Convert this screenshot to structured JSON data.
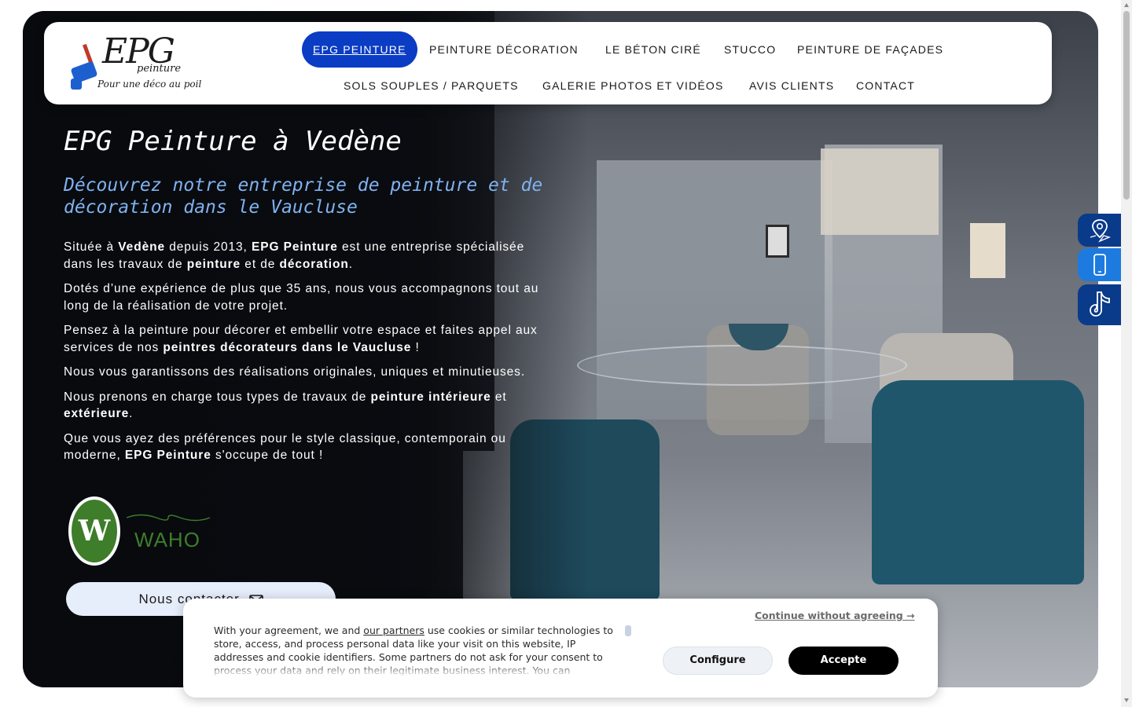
{
  "colors": {
    "nav_active_bg": "#0a3cc4",
    "subtitle": "#7fb2f0",
    "side_map_bg": "#0a3a8a",
    "side_phone_bg": "#1d7be0",
    "waho_green": "#3e7d2a",
    "accept_bg": "#000000"
  },
  "logo": {
    "main": "EPG",
    "sub": "peinture",
    "tagline": "Pour une déco au poil"
  },
  "nav": {
    "items": [
      {
        "label": "EPG PEINTURE",
        "active": true
      },
      {
        "label": "PEINTURE DÉCORATION"
      },
      {
        "label": "LE BÉTON CIRÉ"
      },
      {
        "label": "STUCCO"
      },
      {
        "label": "PEINTURE DE FAÇADES"
      },
      {
        "label": "SOLS SOUPLES / PARQUETS"
      },
      {
        "label": "GALERIE PHOTOS ET VIDÉOS"
      },
      {
        "label": "AVIS CLIENTS"
      },
      {
        "label": "CONTACT"
      }
    ]
  },
  "hero": {
    "title": "EPG Peinture à Vedène",
    "subtitle": "Découvrez notre entreprise de peinture et de décoration dans le Vaucluse",
    "p1": {
      "a": "Située à ",
      "b": "Vedène",
      "c": " depuis 2013, ",
      "d": "EPG Peinture",
      "e": " est une entreprise spécialisée dans les travaux de ",
      "f": "peinture",
      "g": " et de ",
      "h": "décoration",
      "i": "."
    },
    "p2": "Dotés d’une expérience de plus que 35 ans, nous vous accompagnons tout au long de la réalisation de votre projet.",
    "p3": {
      "a": "Pensez à la peinture pour décorer et embellir votre espace et faites appel aux services de nos ",
      "b": "peintres décorateurs dans le Vaucluse",
      "c": " !"
    },
    "p4": "Nous vous garantissons des réalisations originales, uniques et minutieuses.",
    "p5": {
      "a": "Nous prenons en charge tous types de travaux de ",
      "b": "peinture intérieure",
      "c": " et ",
      "d": "extérieure",
      "e": "."
    },
    "p6": {
      "a": "Que vous ayez des préférences pour le style classique, contemporain ou moderne,  ",
      "b": "EPG Peinture",
      "c": " s'occupe de tout !"
    },
    "waho_letter": "W",
    "waho_label": "WAHO",
    "contact_button": "Nous contacter"
  },
  "side_tools": {
    "icons": [
      "map-pin-icon",
      "phone-icon",
      "tiktok-icon"
    ]
  },
  "cookie": {
    "text_a": "With your agreement, we and ",
    "partners_link": "our partners",
    "text_b": " use cookies or similar technologies to store, access, and process personal data like your visit on this website, IP addresses and cookie identifiers. Some partners do not ask for your consent to process your data and rely on their legitimate business interest. You can",
    "continue_link": "Continue without agreeing →",
    "configure_button": "Configure",
    "accept_button": "Accepte"
  }
}
